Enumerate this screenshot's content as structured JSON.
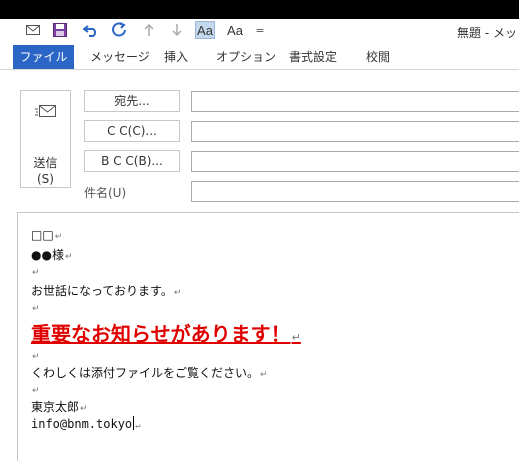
{
  "window": {
    "title": "無題 - メッ"
  },
  "quick_access": [
    {
      "name": "envelope-icon"
    },
    {
      "name": "save-icon"
    },
    {
      "name": "undo-icon"
    },
    {
      "name": "redo-icon"
    },
    {
      "name": "arrow-up-icon"
    },
    {
      "name": "arrow-down-icon"
    },
    {
      "name": "font-aa-active",
      "label": "Aa"
    },
    {
      "name": "font-aa",
      "label": "Aa"
    },
    {
      "name": "customize-icon",
      "label": "="
    }
  ],
  "ribbon_tabs": [
    "ファイル",
    "メッセージ",
    "挿入",
    "オプション",
    "書式設定",
    "校閲"
  ],
  "compose": {
    "send_label_1": "送信",
    "send_label_2": "(S)",
    "to_button": "宛先...",
    "cc_button": "C C(C)...",
    "bcc_button": "B C C(B)...",
    "subject_label": "件名(U)",
    "to_value": "",
    "cc_value": "",
    "bcc_value": "",
    "subject_value": ""
  },
  "body": {
    "line1": "□□",
    "line2": "●●様",
    "line4": "お世話になっております。",
    "important": "重要なお知らせがあります！",
    "line8": "くわしくは添付ファイルをご覧ください。",
    "line10": "東京太郎",
    "line11": "info@bnm.tokyo",
    "paragraph_mark": "↵"
  },
  "colors": {
    "file_tab": "#2b66c6",
    "important_text": "#e00000",
    "titlebar": "#000000"
  }
}
